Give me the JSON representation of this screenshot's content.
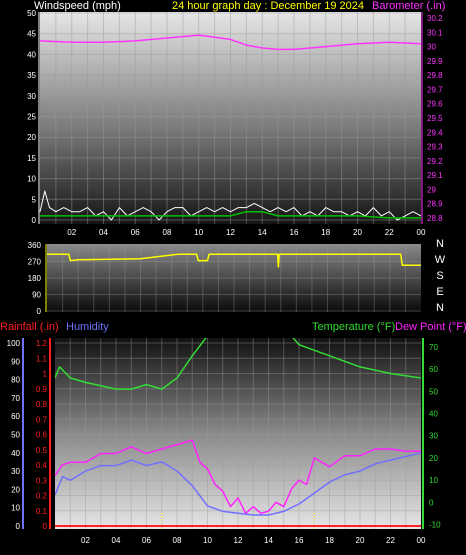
{
  "header": {
    "wind_label": "Windspeed (mph)",
    "date_title": "24 hour graph day : December 19 2024",
    "baro_label": "Barometer (.in)"
  },
  "lower_header": {
    "rain_label": "Rainfall (.in)",
    "hum_label": "Humidity",
    "temp_label": "Temperature (°F)",
    "dew_label": "Dew Point (°F)"
  },
  "colors": {
    "wind": "#ffffff",
    "wind_avg": "#00c000",
    "baro": "#ff33ff",
    "direction": "#ffff00",
    "rain": "#ff2020",
    "humidity": "#7070ff",
    "temperature": "#33dd33",
    "dewpoint": "#ff22ff",
    "axis_white": "#ffffff"
  },
  "chart_data": [
    {
      "type": "line",
      "name": "wind-baro",
      "x_ticks": [
        "02",
        "04",
        "06",
        "08",
        "10",
        "12",
        "14",
        "16",
        "18",
        "20",
        "22",
        "00"
      ],
      "y_left_ticks": [
        "0",
        "5",
        "10",
        "15",
        "20",
        "25",
        "30",
        "35",
        "40",
        "45",
        "50"
      ],
      "y_left_range": [
        0,
        50
      ],
      "y_right_ticks": [
        "28.8",
        "28.9",
        "29",
        "29.1",
        "29.2",
        "29.3",
        "29.4",
        "29.5",
        "29.6",
        "29.7",
        "29.8",
        "29.9",
        "30",
        "30.1",
        "30.2"
      ],
      "y_right_range": [
        28.8,
        30.2
      ],
      "series": [
        {
          "key": "baro",
          "axis": "right",
          "x": [
            0,
            2,
            4,
            6,
            8,
            10,
            12,
            13,
            14,
            15,
            16,
            18,
            20,
            22,
            24
          ],
          "values": [
            30.04,
            30.03,
            30.03,
            30.04,
            30.06,
            30.08,
            30.05,
            30.01,
            29.99,
            29.98,
            29.98,
            30.0,
            30.02,
            30.03,
            30.02
          ]
        },
        {
          "key": "wind",
          "axis": "left",
          "x": [
            0,
            0.3,
            0.6,
            1,
            1.5,
            2,
            2.5,
            3,
            3.5,
            4,
            4.5,
            5,
            5.5,
            6,
            6.5,
            7,
            7.5,
            8,
            8.5,
            9,
            9.5,
            10,
            10.5,
            11,
            11.5,
            12,
            12.5,
            13,
            13.5,
            14,
            14.5,
            15,
            15.5,
            16,
            16.5,
            17,
            17.5,
            18,
            18.5,
            19,
            19.5,
            20,
            20.5,
            21,
            21.5,
            22,
            22.5,
            23,
            23.5,
            24
          ],
          "values": [
            2,
            7,
            3,
            2,
            3,
            2,
            2,
            3,
            1,
            2,
            0,
            3,
            1,
            2,
            3,
            2,
            0,
            2,
            3,
            3,
            1,
            2,
            3,
            2,
            3,
            2,
            3,
            3,
            4,
            3,
            2,
            3,
            2,
            3,
            1,
            2,
            1,
            3,
            2,
            2,
            1,
            2,
            1,
            3,
            1,
            2,
            0,
            1,
            2,
            1
          ]
        },
        {
          "key": "wind_avg",
          "axis": "left",
          "x": [
            0,
            2,
            4,
            6,
            8,
            10,
            12,
            13,
            14,
            15,
            16,
            18,
            20,
            22,
            24
          ],
          "values": [
            1,
            1,
            1,
            1,
            1,
            1,
            1,
            2,
            2,
            1,
            1,
            1,
            1,
            0.5,
            0.5
          ]
        }
      ]
    },
    {
      "type": "line",
      "name": "wind-direction",
      "x_ticks": [
        "02",
        "04",
        "06",
        "08",
        "10",
        "12",
        "14",
        "16",
        "18",
        "20",
        "22",
        "00"
      ],
      "y_ticks": [
        "0",
        "90",
        "180",
        "270",
        "360"
      ],
      "y_range": [
        0,
        360
      ],
      "compass": [
        "N",
        "W",
        "S",
        "E",
        "N"
      ],
      "series": [
        {
          "key": "direction",
          "x": [
            0,
            1.4,
            1.5,
            2,
            6,
            8.4,
            8.5,
            9.6,
            9.7,
            10.3,
            10.4,
            14.8,
            14.85,
            14.9,
            22.7,
            22.8,
            24
          ],
          "values": [
            310,
            310,
            275,
            280,
            285,
            310,
            310,
            310,
            275,
            275,
            310,
            310,
            240,
            310,
            310,
            250,
            250
          ]
        }
      ]
    },
    {
      "type": "line",
      "name": "temp-hum-rain",
      "x_ticks": [
        "02",
        "04",
        "06",
        "08",
        "10",
        "12",
        "14",
        "16",
        "18",
        "20",
        "22",
        "00"
      ],
      "hum_ticks": [
        "0",
        "10",
        "20",
        "30",
        "40",
        "50",
        "60",
        "70",
        "80",
        "90",
        "100"
      ],
      "hum_range": [
        0,
        100
      ],
      "rain_ticks": [
        "0",
        "0.1",
        "0.2",
        "0.3",
        "0.4",
        "0.5",
        "0.6",
        "0.7",
        "0.8",
        "0.9",
        "1",
        "1.1",
        "1.2"
      ],
      "rain_range": [
        0,
        1.2
      ],
      "temp_ticks": [
        "-10",
        "0",
        "10",
        "20",
        "30",
        "40",
        "50",
        "60",
        "70"
      ],
      "temp_range": [
        -10,
        75
      ],
      "series": [
        {
          "key": "temperature",
          "axis": "temp",
          "x": [
            0,
            0.3,
            1,
            2,
            4,
            5,
            6,
            7,
            8,
            9,
            10,
            11,
            13,
            15,
            16,
            18,
            20,
            22,
            24
          ],
          "values": [
            56,
            61,
            56,
            54,
            51,
            51,
            53,
            51,
            56,
            66,
            75,
            80,
            82,
            79,
            71,
            66,
            61,
            58,
            56
          ]
        },
        {
          "key": "dewpoint",
          "axis": "temp",
          "x": [
            0,
            0.5,
            1,
            2,
            3,
            4,
            5,
            6,
            7,
            8,
            9,
            9.5,
            10,
            10.5,
            11,
            11.5,
            12,
            12.5,
            13,
            13.5,
            14,
            14.5,
            15,
            15.5,
            16,
            16.5,
            17,
            18,
            19,
            20,
            21,
            22,
            23,
            24
          ],
          "values": [
            12,
            17,
            18,
            18,
            22,
            22,
            25,
            22,
            24,
            26,
            28,
            18,
            15,
            8,
            5,
            -2,
            2,
            -5,
            -2,
            -5,
            -4,
            0,
            -2,
            6,
            10,
            8,
            20,
            16,
            21,
            21,
            24,
            24,
            23,
            23
          ]
        },
        {
          "key": "humidity",
          "axis": "hum",
          "x": [
            0,
            0.5,
            1,
            2,
            3,
            4,
            5,
            6,
            7,
            8,
            9,
            10,
            11,
            12,
            13,
            14,
            15,
            16,
            17,
            18,
            19,
            20,
            21,
            22,
            23,
            24
          ],
          "values": [
            17,
            27,
            25,
            30,
            33,
            33,
            36,
            33,
            35,
            30,
            22,
            11,
            8,
            7,
            6,
            6,
            8,
            12,
            18,
            24,
            28,
            30,
            34,
            36,
            38,
            40
          ]
        },
        {
          "key": "rain",
          "axis": "rain",
          "x": [
            0,
            24
          ],
          "values": [
            0,
            0
          ]
        }
      ],
      "markers_x": [
        7,
        17
      ]
    }
  ]
}
